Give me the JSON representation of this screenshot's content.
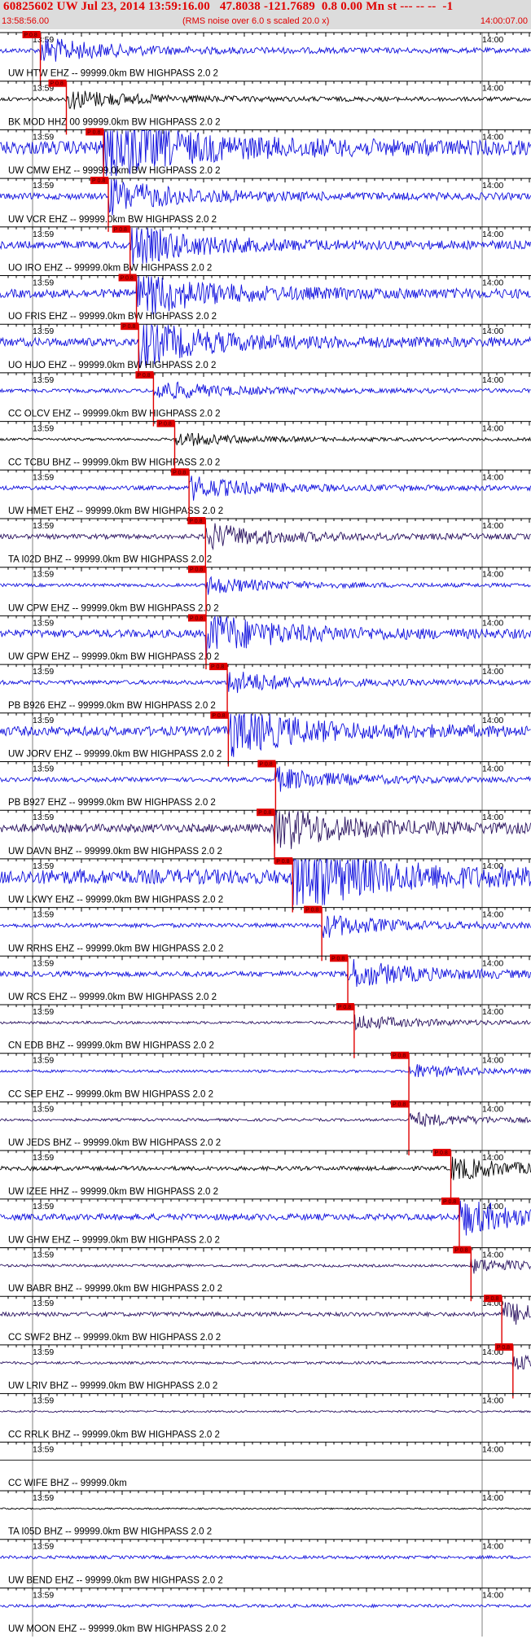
{
  "header": {
    "title": "60825602 UW Jul 23, 2014 13:59:16.00   47.8038 -121.7689  0.8 0.00 Mn st --- -- --  -1",
    "start_time": "13:58:56.00",
    "rms_note": "(RMS noise over 6.0 s scaled 20.0 x)",
    "end_time": "14:00:07.00"
  },
  "tick_labels": {
    "t1359": "13:59",
    "t1400": "14:00"
  },
  "pick_label": "P 0.8",
  "colors": {
    "title": "#e00000",
    "pick": "#e00000",
    "trace_blue": "#1010dd",
    "trace_dark": "#2a1360",
    "trace_black": "#000000"
  },
  "traces": [
    {
      "label": "UW HTW EHZ -- 99999.0km BW  HIGHPASS  2.0  2",
      "color": "blue",
      "pick": 0.076,
      "amp": 0.9
    },
    {
      "label": "BK MOD HHZ 00 99999.0km BW  HIGHPASS  2.0  2",
      "color": "black",
      "pick": 0.125,
      "amp": 0.7
    },
    {
      "label": "UW CMW EHZ -- 99999.0km BW  HIGHPASS  2.0  2",
      "color": "blue",
      "pick": 0.195,
      "amp": 2.6
    },
    {
      "label": "UW VCR EHZ -- 99999.0km BW  HIGHPASS  2.0  2",
      "color": "blue",
      "pick": 0.204,
      "amp": 1.2
    },
    {
      "label": "UO IRO EHZ -- 99999.0km BW  HIGHPASS  2.0  2",
      "color": "blue",
      "pick": 0.245,
      "amp": 1.4
    },
    {
      "label": "UO FRIS EHZ -- 99999.0km BW  HIGHPASS  2.0  2",
      "color": "blue",
      "pick": 0.257,
      "amp": 1.6
    },
    {
      "label": "UO HUO EHZ -- 99999.0km BW  HIGHPASS  2.0  2",
      "color": "blue",
      "pick": 0.261,
      "amp": 1.6
    },
    {
      "label": "CC OLCV EHZ -- 99999.0km BW  HIGHPASS  2.0  2",
      "color": "blue",
      "pick": 0.289,
      "amp": 0.7
    },
    {
      "label": "CC TCBU BHZ -- 99999.0km BW  HIGHPASS  2.0  2",
      "color": "black",
      "pick": 0.329,
      "amp": 0.5
    },
    {
      "label": "UW HMET EHZ -- 99999.0km BW  HIGHPASS  2.0  2",
      "color": "blue",
      "pick": 0.356,
      "amp": 0.8
    },
    {
      "label": "TA I02D BHZ -- 99999.0km BW  HIGHPASS  2.0  2",
      "color": "dark",
      "pick": 0.387,
      "amp": 0.9
    },
    {
      "label": "UW CPW EHZ -- 99999.0km BW  HIGHPASS  2.0  2",
      "color": "blue",
      "pick": 0.388,
      "amp": 0.6
    },
    {
      "label": "UW GPW EHZ -- 99999.0km BW  HIGHPASS  2.0  2",
      "color": "blue",
      "pick": 0.388,
      "amp": 1.5
    },
    {
      "label": "PB B926 EHZ -- 99999.0km BW  HIGHPASS  2.0  2",
      "color": "blue",
      "pick": 0.428,
      "amp": 0.8
    },
    {
      "label": "UW JORV EHZ -- 99999.0km BW  HIGHPASS  2.0  2",
      "color": "blue",
      "pick": 0.43,
      "amp": 1.8
    },
    {
      "label": "PB B927 EHZ -- 99999.0km BW  HIGHPASS  2.0  2",
      "color": "blue",
      "pick": 0.519,
      "amp": 0.8
    },
    {
      "label": "UW DAVN BHZ -- 99999.0km BW  HIGHPASS  2.0  2",
      "color": "dark",
      "pick": 0.517,
      "amp": 1.6
    },
    {
      "label": "UW LKWY EHZ -- 99999.0km BW  HIGHPASS  2.0  2",
      "color": "blue",
      "pick": 0.551,
      "amp": 2.8
    },
    {
      "label": "UW RRHS EHZ -- 99999.0km BW  HIGHPASS  2.0  2",
      "color": "blue",
      "pick": 0.606,
      "amp": 0.8
    },
    {
      "label": "UW RCS EHZ -- 99999.0km BW  HIGHPASS  2.0  2",
      "color": "blue",
      "pick": 0.655,
      "amp": 1.0
    },
    {
      "label": "CN EDB BHZ -- 99999.0km BW  HIGHPASS  2.0  2",
      "color": "dark",
      "pick": 0.667,
      "amp": 0.5
    },
    {
      "label": "CC SEP EHZ -- 99999.0km BW  HIGHPASS  2.0  2",
      "color": "blue",
      "pick": 0.77,
      "amp": 0.5
    },
    {
      "label": "UW JEDS BHZ -- 99999.0km BW  HIGHPASS  2.0  2",
      "color": "dark",
      "pick": 0.77,
      "amp": 0.5
    },
    {
      "label": "UW IZEE HHZ -- 99999.0km BW  HIGHPASS  2.0  2",
      "color": "black",
      "pick": 0.849,
      "amp": 0.8
    },
    {
      "label": "UW GHW EHZ -- 99999.0km BW  HIGHPASS  2.0  2",
      "color": "blue",
      "pick": 0.865,
      "amp": 1.2
    },
    {
      "label": "UW BABR BHZ -- 99999.0km BW  HIGHPASS  2.0  2",
      "color": "dark",
      "pick": 0.887,
      "amp": 0.5
    },
    {
      "label": "CC SWF2 BHZ -- 99999.0km BW  HIGHPASS  2.0  2",
      "color": "dark",
      "pick": 0.945,
      "amp": 0.8
    },
    {
      "label": "UW LRIV BHZ -- 99999.0km BW  HIGHPASS  2.0  2",
      "color": "dark",
      "pick": 0.966,
      "amp": 0.5
    },
    {
      "label": "CC RRLK BHZ -- 99999.0km BW  HIGHPASS  2.0  2",
      "color": "dark",
      "pick": null,
      "amp": 0.35
    },
    {
      "label": "CC WIFE BHZ -- 99999.0km",
      "color": "black",
      "pick": null,
      "amp": 0.0
    },
    {
      "label": "TA I05D BHZ -- 99999.0km BW  HIGHPASS  2.0  2",
      "color": "black",
      "pick": null,
      "amp": 0.3
    },
    {
      "label": "UW BEND EHZ -- 99999.0km BW  HIGHPASS  2.0  2",
      "color": "blue",
      "pick": null,
      "amp": 0.6
    },
    {
      "label": "UW MOON EHZ -- 99999.0km BW  HIGHPASS  2.0  2",
      "color": "blue",
      "pick": null,
      "amp": 0.6
    }
  ]
}
